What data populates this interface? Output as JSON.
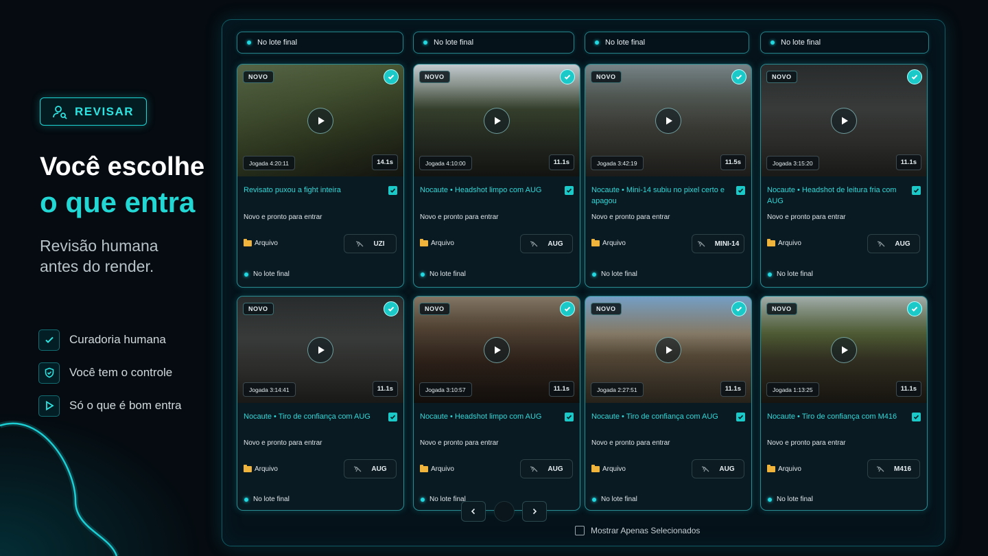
{
  "left": {
    "badge": "REVISAR",
    "headline_line1": "Você escolhe",
    "headline_line2": "o que entra",
    "sub_line1": "Revisão humana",
    "sub_line2": "antes do render.",
    "features": [
      {
        "label": "Curadoria humana",
        "icon": "check-icon"
      },
      {
        "label": "Você tem o controle",
        "icon": "shield-icon"
      },
      {
        "label": "Só o que é bom entra",
        "icon": "play-icon"
      }
    ]
  },
  "columns": [
    {
      "header": "No lote final"
    },
    {
      "header": "No lote final"
    },
    {
      "header": "No lote final"
    },
    {
      "header": "No lote final"
    }
  ],
  "cards": [
    {
      "novo": "NOVO",
      "jogada": "Jogada 4:20:11",
      "duration": "14.1s",
      "title": "Revisato puxou a fight inteira",
      "status": "Novo e pronto para entrar",
      "folder": "Arquivo",
      "weapon": "UZI",
      "lote": "No lote final",
      "scene": "grass"
    },
    {
      "novo": "NOVO",
      "jogada": "Jogada 4:10:00",
      "duration": "11.1s",
      "title": "Nocaute • Headshot limpo com AUG",
      "status": "Novo e pronto para entrar",
      "folder": "Arquivo",
      "weapon": "AUG",
      "lote": "No lote final",
      "scene": "road"
    },
    {
      "novo": "NOVO",
      "jogada": "Jogada 3:42:19",
      "duration": "11.5s",
      "title": "Nocaute • Mini-14 subiu no pixel certo e apagou",
      "status": "Novo e pronto para entrar",
      "folder": "Arquivo",
      "weapon": "MINI-14",
      "lote": "No lote final",
      "scene": "street"
    },
    {
      "novo": "NOVO",
      "jogada": "Jogada 3:15:20",
      "duration": "11.1s",
      "title": "Nocaute • Headshot de leitura fria com AUG",
      "status": "Novo e pronto para entrar",
      "folder": "Arquivo",
      "weapon": "AUG",
      "lote": "No lote final",
      "scene": "indoor"
    },
    {
      "novo": "NOVO",
      "jogada": "Jogada 3:14:41",
      "duration": "11.1s",
      "title": "Nocaute • Tiro de confiança com AUG",
      "status": "Novo e pronto para entrar",
      "folder": "Arquivo",
      "weapon": "AUG",
      "lote": "No lote final",
      "scene": "indoor"
    },
    {
      "novo": "NOVO",
      "jogada": "Jogada 3:10:57",
      "duration": "11.1s",
      "title": "Nocaute • Headshot limpo com AUG",
      "status": "Novo e pronto para entrar",
      "folder": "Arquivo",
      "weapon": "AUG",
      "lote": "No lote final",
      "scene": "dusk"
    },
    {
      "novo": "NOVO",
      "jogada": "Jogada 2:27:51",
      "duration": "11.1s",
      "title": "Nocaute • Tiro de confiança com AUG",
      "status": "Novo e pronto para entrar",
      "folder": "Arquivo",
      "weapon": "AUG",
      "lote": "No lote final",
      "scene": "town"
    },
    {
      "novo": "NOVO",
      "jogada": "Jogada 1:13:25",
      "duration": "11.1s",
      "title": "Nocaute • Tiro de confiança com M416",
      "status": "Novo e pronto para entrar",
      "folder": "Arquivo",
      "weapon": "M416",
      "lote": "No lote final",
      "scene": "hill"
    }
  ],
  "pagination": {
    "prev": "chevron-left-icon",
    "next": "chevron-right-icon"
  },
  "show_selected": "Mostrar Apenas Selecionados",
  "colors": {
    "accent": "#22d7d4",
    "bg": "#050b10",
    "panel_border": "#0f5a63"
  }
}
